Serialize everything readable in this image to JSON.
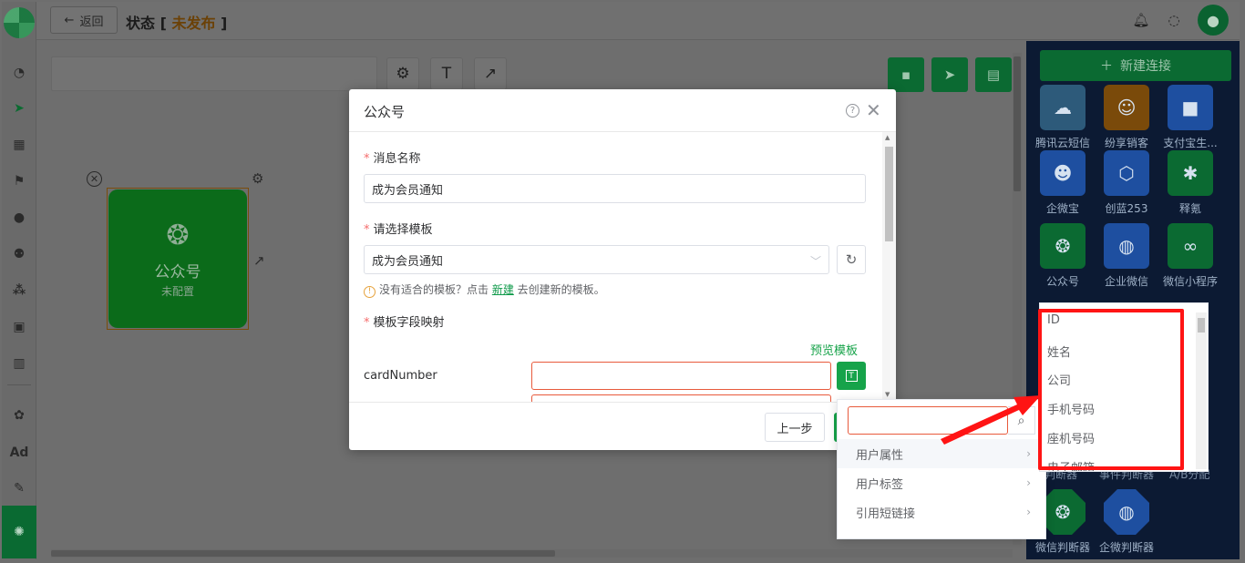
{
  "header": {
    "back_label": "返回",
    "title_prefix": "状态 [ ",
    "status": "未发布",
    "title_suffix": " ]"
  },
  "icons": {
    "back": "arrow-left-icon",
    "bell": "bell-icon",
    "chat": "message-icon",
    "user": "user-avatar-icon"
  },
  "toolbar": {
    "settings_icon": "gear-icon",
    "text_icon": "T",
    "arrow_icon": "diagonal-arrow-icon"
  },
  "node": {
    "title": "公众号",
    "subtitle": "未配置"
  },
  "palette": {
    "new_connection": "新建连接",
    "items": [
      {
        "label": "腾讯云短信",
        "color": "#2d5a7a"
      },
      {
        "label": "纷享销客",
        "color": "#7a4a0a"
      },
      {
        "label": "支付宝生...",
        "color": "#1e4fa0"
      },
      {
        "label": "企微宝",
        "color": "#1e4fa0"
      },
      {
        "label": "创蓝253",
        "color": "#1e4fa0"
      },
      {
        "label": "释氪",
        "color": "#0b6a32"
      },
      {
        "label": "公众号",
        "color": "#0b6a32"
      },
      {
        "label": "企业微信",
        "color": "#1e4fa0"
      },
      {
        "label": "微信小程序",
        "color": "#0b6a32"
      },
      {
        "label": "微信判断器",
        "color": "#0b6a32"
      },
      {
        "label": "企微判断器",
        "color": "#1e4fa0"
      }
    ],
    "partial_labels": [
      "性判断器",
      "事件判断器",
      "A/B分配"
    ]
  },
  "dialog": {
    "title": "公众号",
    "msg_name_label": "消息名称",
    "msg_name_value": "成为会员通知",
    "template_label": "请选择模板",
    "template_value": "成为会员通知",
    "tip_prefix": "没有适合的模板？点击 ",
    "tip_link": "新建",
    "tip_suffix": " 去创建新的模板。",
    "mapping_label": "模板字段映射",
    "preview_link": "预览模板",
    "field_key": "cardNumber",
    "prev_button": "上一步"
  },
  "cascader": {
    "menu": [
      "用户属性",
      "用户标签",
      "引用短链接"
    ],
    "sub_items": [
      "ID",
      "姓名",
      "公司",
      "手机号码",
      "座机号码",
      "电子邮箱"
    ]
  },
  "colors": {
    "accent": "#16a34a",
    "status": "#e8a317",
    "highlight": "#ff1414"
  }
}
